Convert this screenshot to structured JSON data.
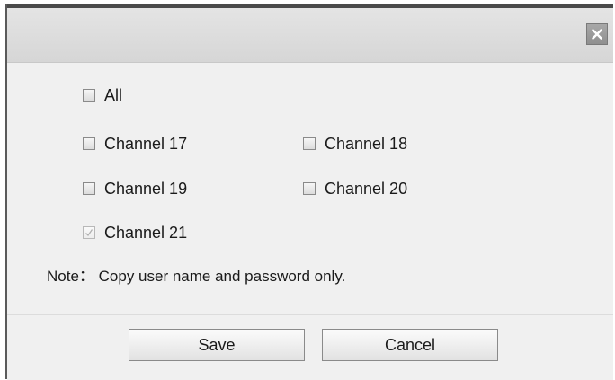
{
  "dialog": {
    "close_icon": "close-icon"
  },
  "options": {
    "all": {
      "label": "All",
      "checked": false
    },
    "channels": [
      {
        "label": "Channel 17",
        "checked": false
      },
      {
        "label": "Channel 18",
        "checked": false
      },
      {
        "label": "Channel 19",
        "checked": false
      },
      {
        "label": "Channel 20",
        "checked": false
      },
      {
        "label": "Channel 21",
        "checked": true,
        "disabled": true
      }
    ]
  },
  "note": "Note： Copy user name and password only.",
  "buttons": {
    "save": "Save",
    "cancel": "Cancel"
  }
}
